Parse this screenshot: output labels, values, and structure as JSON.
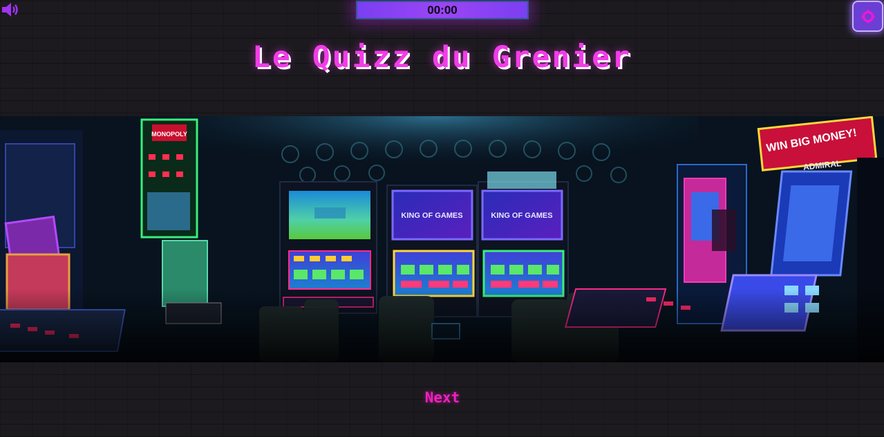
{
  "header": {
    "timer": "00:00",
    "sound_icon": "volume-icon",
    "settings_icon": "settings-gear-icon"
  },
  "title": "Le Quizz du Grenier",
  "hero": {
    "image_name": "arcade-room-photo",
    "signs": {
      "monopoly": "MONOPOLY",
      "win_big_money": "WIN BIG MONEY!",
      "admiral": "ADMIRAL",
      "king_of_games_1": "KING OF GAMES",
      "king_of_games_2": "KING OF GAMES"
    }
  },
  "footer": {
    "next_label": "Next"
  },
  "colors": {
    "background": "#1c1a1f",
    "title": "#f23ce8",
    "timer_bar": "#9b45f5",
    "next": "#f01fbf",
    "settings_button": "#6b3fd4"
  }
}
